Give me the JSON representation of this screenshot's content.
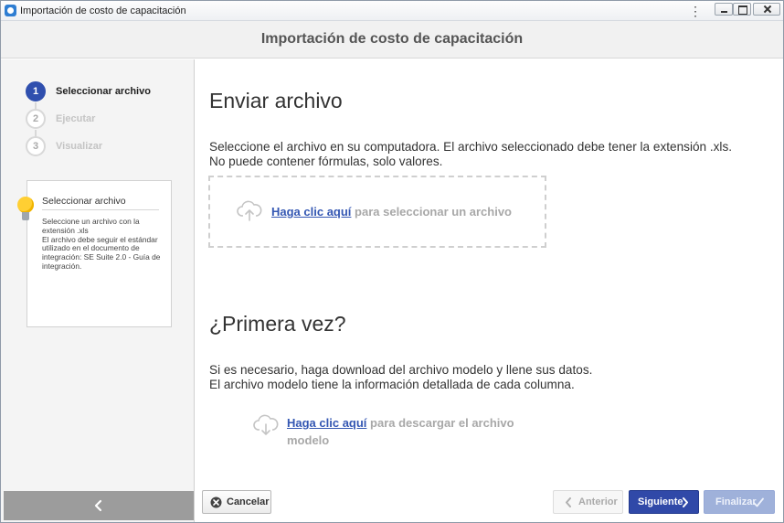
{
  "window": {
    "title": "Importación de costo de capacitación"
  },
  "header": {
    "title": "Importación de costo de capacitación"
  },
  "wizard": {
    "steps": [
      {
        "number": "1",
        "label": "Seleccionar archivo",
        "state": "active"
      },
      {
        "number": "2",
        "label": "Ejecutar",
        "state": "inactive"
      },
      {
        "number": "3",
        "label": "Visualizar",
        "state": "inactive"
      }
    ],
    "help": {
      "title": "Seleccionar archivo",
      "text": "Seleccione un archivo con la extensión .xls\nEl archivo debe seguir el estándar utilizado en el documento de integración: SE Suite 2.0 - Guía de integración."
    }
  },
  "upload": {
    "heading": "Enviar archivo",
    "line1": "Seleccione el archivo en su computadora. El archivo seleccionado debe tener la extensión .xls.",
    "line2": "No puede contener fórmulas, solo valores.",
    "link": "Haga clic aquí",
    "link_rest": " para seleccionar un archivo"
  },
  "first_time": {
    "heading": "¿Primera vez?",
    "line1": "Si es necesario, haga download del archivo modelo y llene sus datos.",
    "line2": "El archivo modelo tiene la información detallada de cada columna.",
    "link": "Haga clic aquí",
    "link_rest": " para descargar el archivo modelo"
  },
  "footer": {
    "cancel": "Cancelar",
    "previous": "Anterior",
    "next": "Siguiente",
    "finish": "Finalizar"
  },
  "colors": {
    "primary": "#3049a8",
    "link": "#3457b3",
    "sidebar_bg": "#f4f4f4",
    "bulb": "#ffcf33"
  },
  "icons": [
    "app-icon",
    "more-vertical-icon",
    "minimize-icon",
    "maximize-icon",
    "close-icon",
    "lightbulb-icon",
    "chevron-left-icon",
    "cloud-upload-icon",
    "cloud-download-icon",
    "cancel-circle-icon",
    "chevron-right-icon",
    "checkmark-icon"
  ]
}
